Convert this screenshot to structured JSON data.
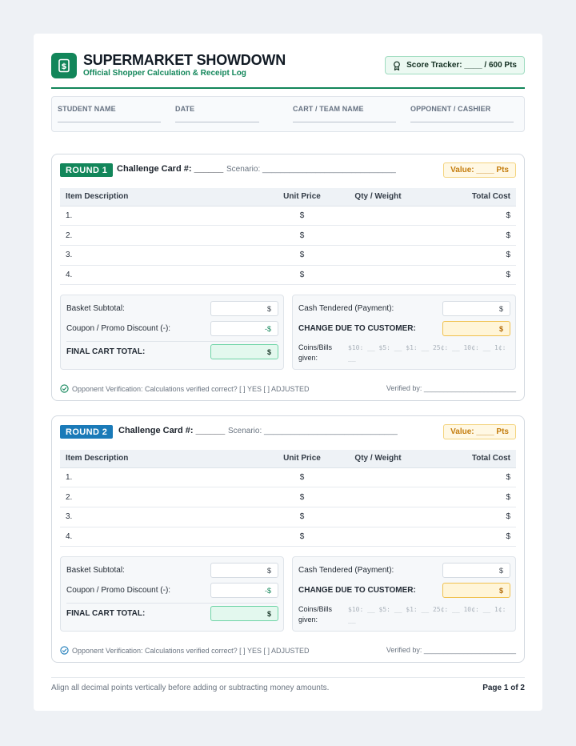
{
  "header": {
    "title": "SUPERMARKET SHOWDOWN",
    "subtitle": "Official Shopper Calculation & Receipt Log",
    "score_tracker": "Score Tracker: ____ / 600 Pts",
    "logo_icon": "dollar-receipt-icon",
    "score_icon": "award-ribbon-icon"
  },
  "info_fields": [
    "STUDENT NAME",
    "DATE",
    "CART / TEAM NAME",
    "OPPONENT / CASHIER"
  ],
  "colors": {
    "green": "#12865a",
    "round1": "#12865a",
    "round2": "#1a7ab8",
    "amber": "#f3d37d"
  },
  "rounds": [
    {
      "badge": "ROUND 1",
      "challenge": "Challenge Card #: ______",
      "scenario": "Scenario: ______________________________",
      "value": "Value: ____ Pts",
      "table": {
        "headers": [
          "Item Description",
          "Unit Price",
          "Qty / Weight",
          "Total Cost"
        ],
        "rows": [
          [
            "1.",
            "$",
            "",
            "$"
          ],
          [
            "2.",
            "$",
            "",
            "$"
          ],
          [
            "3.",
            "$",
            "",
            "$"
          ],
          [
            "4.",
            "$",
            "",
            "$"
          ]
        ]
      },
      "left_box": {
        "basket_label": "Basket Subtotal:",
        "basket_value": "$",
        "coupon_label": "Coupon / Promo Discount (-):",
        "coupon_value": "-$",
        "final_label": "FINAL CART TOTAL:",
        "final_value": "$"
      },
      "right_box": {
        "cash_label": "Cash Tendered (Payment):",
        "cash_value": "$",
        "change_label": "CHANGE DUE TO CUSTOMER:",
        "change_value": "$",
        "coins_label": "Coins/Bills given:",
        "coins_line": "$10: __ $5: __ $1: __ 25¢: __ 10¢: __ 1¢: __"
      },
      "verification": "Opponent Verification: Calculations verified correct?  [  ] YES   [  ] ADJUSTED",
      "verified_by": "Verified by: _______________________"
    },
    {
      "badge": "ROUND 2",
      "challenge": "Challenge Card #: ______",
      "scenario": "Scenario: ______________________________",
      "value": "Value: ____ Pts",
      "table": {
        "headers": [
          "Item Description",
          "Unit Price",
          "Qty / Weight",
          "Total Cost"
        ],
        "rows": [
          [
            "1.",
            "$",
            "",
            "$"
          ],
          [
            "2.",
            "$",
            "",
            "$"
          ],
          [
            "3.",
            "$",
            "",
            "$"
          ],
          [
            "4.",
            "$",
            "",
            "$"
          ]
        ]
      },
      "left_box": {
        "basket_label": "Basket Subtotal:",
        "basket_value": "$",
        "coupon_label": "Coupon / Promo Discount (-):",
        "coupon_value": "-$",
        "final_label": "FINAL CART TOTAL:",
        "final_value": "$"
      },
      "right_box": {
        "cash_label": "Cash Tendered (Payment):",
        "cash_value": "$",
        "change_label": "CHANGE DUE TO CUSTOMER:",
        "change_value": "$",
        "coins_label": "Coins/Bills given:",
        "coins_line": "$10: __ $5: __ $1: __ 25¢: __ 10¢: __ 1¢: __"
      },
      "verification": "Opponent Verification: Calculations verified correct?  [  ] YES   [  ] ADJUSTED",
      "verified_by": "Verified by: _______________________"
    }
  ],
  "footer": {
    "note": "Align all decimal points vertically before adding or subtracting money amounts.",
    "page": "Page 1 of 2"
  }
}
